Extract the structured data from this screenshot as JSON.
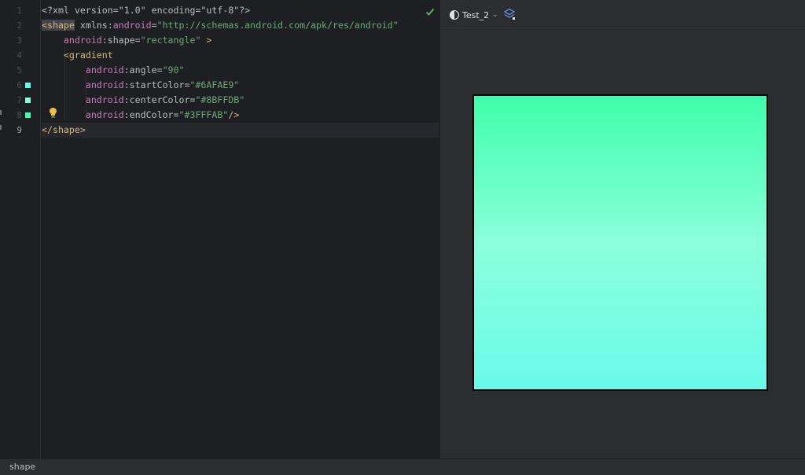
{
  "editor": {
    "line_numbers": [
      "1",
      "2",
      "3",
      "4",
      "5",
      "6",
      "7",
      "8",
      "9"
    ],
    "current_line": "9",
    "lines": [
      [
        {
          "t": "pi",
          "v": "<?xml version=\"1.0\" encoding=\"utf-8\"?>"
        }
      ],
      [
        {
          "t": "tag hl",
          "v": "<shape"
        },
        {
          "t": "attr",
          "v": " xmlns:"
        },
        {
          "t": "ns",
          "v": "android"
        },
        {
          "t": "punc",
          "v": "="
        },
        {
          "t": "str",
          "v": "\"http://schemas.android.com/apk/res/android\""
        }
      ],
      [
        {
          "t": "ns",
          "v": "    android"
        },
        {
          "t": "attr",
          "v": ":shape="
        },
        {
          "t": "str",
          "v": "\"rectangle\""
        },
        {
          "t": "tag",
          "v": " >"
        }
      ],
      [
        {
          "t": "tag",
          "v": "    <gradient"
        }
      ],
      [
        {
          "t": "ns",
          "v": "        android"
        },
        {
          "t": "attr",
          "v": ":angle="
        },
        {
          "t": "str",
          "v": "\"90\""
        }
      ],
      [
        {
          "t": "ns",
          "v": "        android"
        },
        {
          "t": "attr",
          "v": ":startColor="
        },
        {
          "t": "str",
          "v": "\"#6AFAE9\""
        }
      ],
      [
        {
          "t": "ns",
          "v": "        android"
        },
        {
          "t": "attr",
          "v": ":centerColor="
        },
        {
          "t": "str",
          "v": "\"#8BFFDB\""
        }
      ],
      [
        {
          "t": "ns",
          "v": "        android"
        },
        {
          "t": "attr",
          "v": ":endColor="
        },
        {
          "t": "str",
          "v": "\"#3FFFAB\""
        },
        {
          "t": "tag",
          "v": "/>"
        }
      ],
      [
        {
          "t": "tag",
          "v": "</shape>"
        }
      ]
    ],
    "swatches": [
      {
        "line": "6",
        "color": "#6AFAE9"
      },
      {
        "line": "7",
        "color": "#8BFFDB"
      },
      {
        "line": "8",
        "color": "#3FFFAB"
      }
    ],
    "icons": {
      "bulb": "lightbulb-icon",
      "check": "check-icon"
    }
  },
  "preview": {
    "theme_label": "Test_2",
    "icons": {
      "theme": "contrast-icon",
      "dropdown": "chevron-down-icon",
      "layers": "layers-icon"
    },
    "gradient": {
      "start": "#6AFAE9",
      "center": "#8BFFDB",
      "end": "#3FFFAB",
      "angle": "90"
    }
  },
  "statusbar": {
    "breadcrumb": "shape"
  },
  "colors": {
    "accent": "#3574f0",
    "background": "#1e1f22",
    "panel": "#2b2d30"
  }
}
